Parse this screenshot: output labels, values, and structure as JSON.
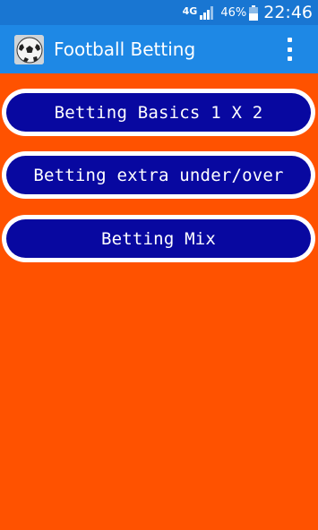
{
  "status_bar": {
    "network": "4G",
    "battery_percent": "46%",
    "time": "22:46"
  },
  "app_bar": {
    "title": "Football Betting",
    "icon": "soccer-ball-icon",
    "menu_icon": "overflow-menu-icon"
  },
  "menu": {
    "items": [
      {
        "label": "Betting Basics 1 X 2"
      },
      {
        "label": "Betting extra under/over"
      },
      {
        "label": "Betting Mix"
      }
    ]
  },
  "colors": {
    "status_bar": "#1976d2",
    "app_bar": "#1e88e5",
    "background": "#ff5200",
    "button_fill": "#0808a0",
    "button_border": "#ffffff"
  }
}
